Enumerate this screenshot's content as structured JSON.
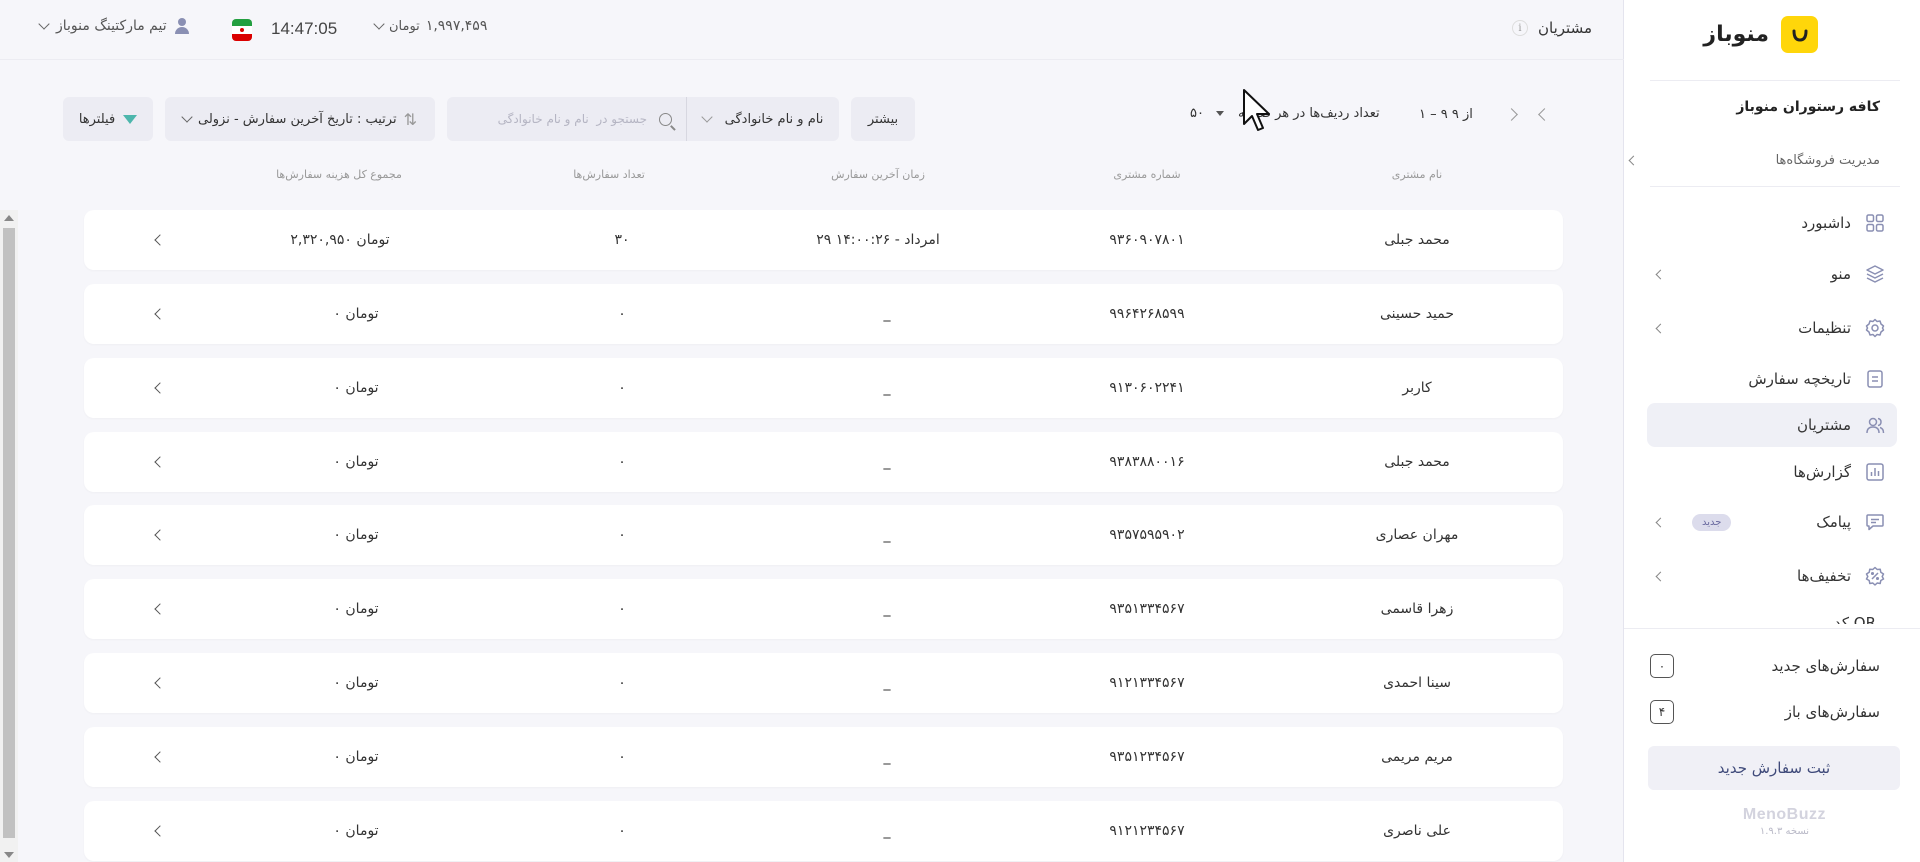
{
  "header": {
    "page_title": "مشتریان",
    "info_label": "i",
    "user_name": "تیم مارکتینگ منوباز",
    "clock": "14:47:05",
    "wallet_amount": "۱,۹۹۷,۴۵۹",
    "wallet_currency": "تومان",
    "flag_colors": [
      "#239f40",
      "#ffffff",
      "#da0000"
    ]
  },
  "toolbar": {
    "filters_label": "فیلترها",
    "sort_label": "ترتیب : تاریخ آخرین سفارش - نزولی",
    "search_placeholder": "جستجو در  نام و نام خانوادگی",
    "search_field": "نام و نام خانوادگی",
    "more_label": "بیشتر",
    "rows_per_page_label": "تعداد ردیف‌ها در هر صفحه",
    "rows_per_page_value": "۵۰",
    "page_range": "۱ – ۹ از ۹"
  },
  "table": {
    "columns": [
      "نام مشتری",
      "شماره مشتری",
      "زمان آخرین سفارش",
      "تعداد سفارش‌ها",
      "مجموع کل هزینه سفارش‌ها"
    ],
    "rows": [
      {
        "name": "محمد جبلی",
        "phone": "۹۳۶۰۹۰۷۸۰۱",
        "last_order": "۲۹ امرداد - ۱۴:۰۰:۲۶",
        "count": "۳۰",
        "total": "۲,۳۲۰,۹۵۰ تومان"
      },
      {
        "name": "حمید حسینی",
        "phone": "۹۹۶۴۲۶۸۵۹۹",
        "last_order": "_",
        "count": "۰",
        "total": "۰ تومان"
      },
      {
        "name": "کاربر",
        "phone": "۹۱۳۰۶۰۲۲۴۱",
        "last_order": "_",
        "count": "۰",
        "total": "۰ تومان"
      },
      {
        "name": "محمد جبلی",
        "phone": "۹۳۸۳۸۸۰۰۱۶",
        "last_order": "_",
        "count": "۰",
        "total": "۰ تومان"
      },
      {
        "name": "مهران عصاری",
        "phone": "۹۳۵۷۵۹۵۹۰۲",
        "last_order": "_",
        "count": "۰",
        "total": "۰ تومان"
      },
      {
        "name": "زهرا قاسمی",
        "phone": "۹۳۵۱۳۳۴۵۶۷",
        "last_order": "_",
        "count": "۰",
        "total": "۰ تومان"
      },
      {
        "name": "سینا احمدی",
        "phone": "۹۱۲۱۳۳۴۵۶۷",
        "last_order": "_",
        "count": "۰",
        "total": "۰ تومان"
      },
      {
        "name": "مریم مریمی",
        "phone": "۹۳۵۱۲۳۴۵۶۷",
        "last_order": "_",
        "count": "۰",
        "total": "۰ تومان"
      },
      {
        "name": "علی ناصری",
        "phone": "۹۱۲۱۲۳۴۵۶۷",
        "last_order": "_",
        "count": "۰",
        "total": "۰ تومان"
      }
    ]
  },
  "sidebar": {
    "brand_name": "منوباز",
    "brand_color": "#ffd60a",
    "store_name": "کافه رستوران منوباز",
    "store_management": "مدیریت فروشگاه‌ها",
    "items": [
      {
        "label": "داشبورد",
        "icon": "grid-icon",
        "has_chevron": false
      },
      {
        "label": "منو",
        "icon": "layers-icon",
        "has_chevron": true
      },
      {
        "label": "تنظیمات",
        "icon": "gear-icon",
        "has_chevron": true
      },
      {
        "label": "تاریخچه سفارش",
        "icon": "receipt-icon",
        "has_chevron": false
      },
      {
        "label": "مشتریان",
        "icon": "users-icon",
        "has_chevron": false,
        "active": true
      },
      {
        "label": "گزارش‌ها",
        "icon": "chart-icon",
        "has_chevron": false
      },
      {
        "label": "پیامک",
        "icon": "message-icon",
        "has_chevron": true,
        "badge": "جدید"
      },
      {
        "label": "تخفیف‌ها",
        "icon": "discount-icon",
        "has_chevron": true
      }
    ],
    "partial_item": "QR کد",
    "new_orders_label": "سفارش‌های جدید",
    "new_orders_count": "۰",
    "open_orders_label": "سفارش‌های باز",
    "open_orders_count": "۴",
    "new_order_button": "ثبت سفارش جدید",
    "footer_brand": "MenoBuzz",
    "version": "نسخه ۱.۹.۳"
  }
}
